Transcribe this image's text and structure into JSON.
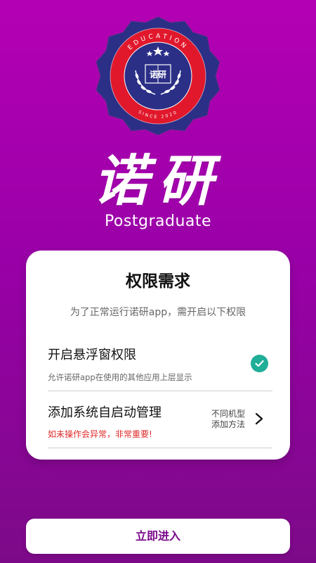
{
  "logo": {
    "arc_top": "EDUCATION",
    "arc_bottom": "SINCE 2020",
    "book_text": "诺研",
    "colors": {
      "outer": "#2b2f86",
      "ring": "#e1182c",
      "inner": "#2b2f86"
    }
  },
  "brand": {
    "name_cn": "诺研",
    "name_en": "Postgraduate"
  },
  "card": {
    "title": "权限需求",
    "subtitle": "为了正常运行诺研app，需开启以下权限",
    "permissions": [
      {
        "title": "开启悬浮窗权限",
        "description": "允许诺研app在使用的其他应用上层显示",
        "status_icon": "check-icon",
        "status_color": "#1fae98"
      },
      {
        "title": "添加系统自启动管理",
        "warning": "如未操作会异常，非常重要!",
        "hint_line1": "不同机型",
        "hint_line2": "添加方法",
        "action_icon": "chevron-right-icon",
        "warning_color": "#e02b2b"
      }
    ]
  },
  "enter_button": {
    "label": "立即进入",
    "color": "#7a0a8a"
  },
  "background": {
    "top": "#b400b4",
    "bottom": "#7c0a88"
  }
}
